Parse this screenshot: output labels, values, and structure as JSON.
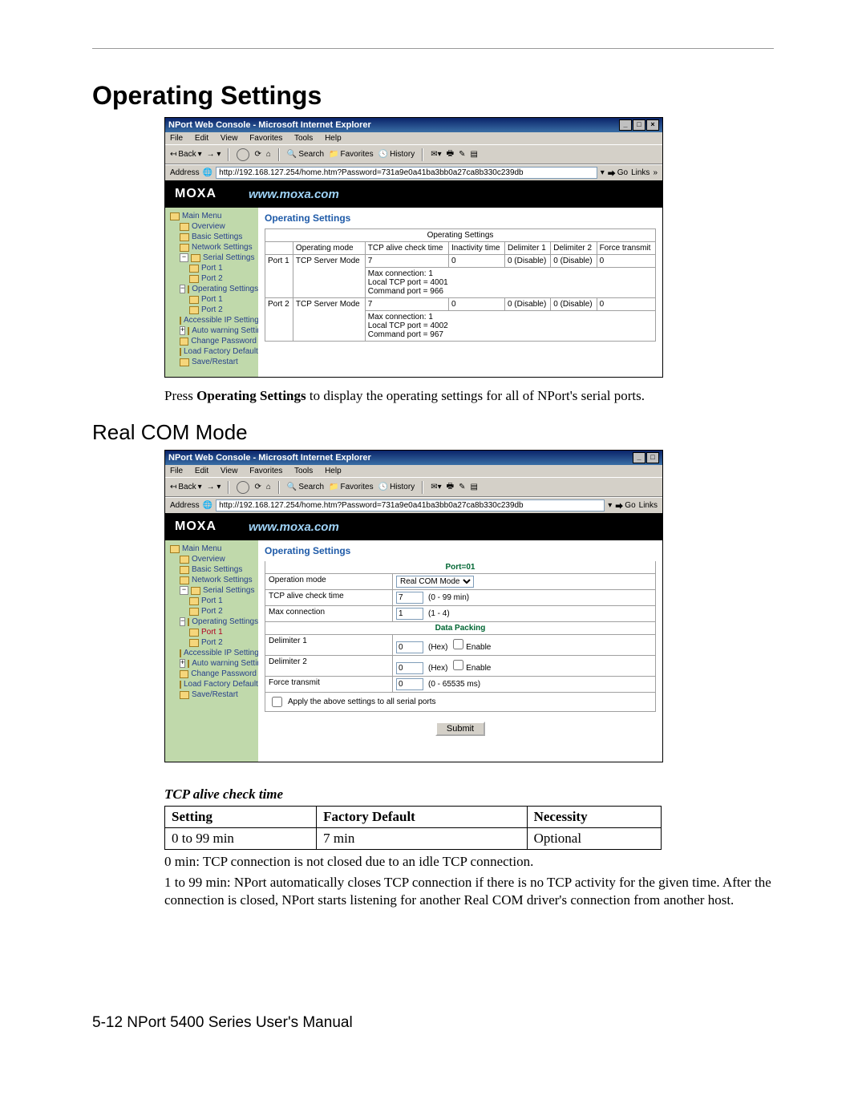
{
  "page": {
    "h1": "Operating Settings",
    "h2": "Real COM Mode",
    "footer": "5-12  NPort 5400 Series User's Manual"
  },
  "browser": {
    "title": "NPort Web Console - Microsoft Internet Explorer",
    "menu": {
      "file": "File",
      "edit": "Edit",
      "view": "View",
      "favorites": "Favorites",
      "tools": "Tools",
      "help": "Help"
    },
    "toolbar": {
      "back": "Back",
      "search": "Search",
      "fav": "Favorites",
      "hist": "History"
    },
    "address_label": "Address",
    "address_value": "http://192.168.127.254/home.htm?Password=731a9e0a41ba3bb0a27ca8b330c239db",
    "go": "Go",
    "links": "Links"
  },
  "brand": {
    "logo": "MOXA",
    "url": "www.moxa.com"
  },
  "nav": {
    "main": "Main Menu",
    "overview": "Overview",
    "basic": "Basic Settings",
    "network": "Network Settings",
    "serial": "Serial Settings",
    "port1": "Port 1",
    "port2": "Port 2",
    "operating": "Operating Settings",
    "accip": "Accessible IP Settings",
    "autowarn": "Auto warning Settings",
    "chgpw": "Change Password",
    "loadfact": "Load Factory Default",
    "save": "Save/Restart"
  },
  "shot1": {
    "label": "Operating Settings",
    "table_caption": "Operating Settings",
    "headers": {
      "port": "",
      "mode": "Operating mode",
      "tcp": "TCP alive check time",
      "inact": "Inactivity time",
      "d1": "Delimiter 1",
      "d2": "Delimiter 2",
      "ft": "Force transmit"
    },
    "rows": [
      {
        "port": "Port 1",
        "mode": "TCP Server Mode",
        "tcp": "7",
        "inact": "0",
        "d1": "0 (Disable)",
        "d2": "0 (Disable)",
        "ft": "0",
        "detail": "Max connection: 1\nLocal TCP port = 4001\nCommand port = 966"
      },
      {
        "port": "Port 2",
        "mode": "TCP Server Mode",
        "tcp": "7",
        "inact": "0",
        "d1": "0 (Disable)",
        "d2": "0 (Disable)",
        "ft": "0",
        "detail": "Max connection: 1\nLocal TCP port = 4002\nCommand port = 967"
      }
    ]
  },
  "caption1_pre": "Press ",
  "caption1_b": "Operating Settings",
  "caption1_post": " to display the operating settings for all of NPort's serial ports.",
  "shot2": {
    "label": "Operating Settings",
    "port_header": "Port=01",
    "opmode_label": "Operation mode",
    "opmode_value": "Real COM Mode",
    "tcp_label": "TCP alive check time",
    "tcp_value": "7",
    "tcp_hint": "(0 - 99 min)",
    "max_label": "Max connection",
    "max_value": "1",
    "max_hint": "(1 - 4)",
    "pack_header": "Data Packing",
    "d1_label": "Delimiter 1",
    "d1_value": "0",
    "hex": "(Hex)",
    "enable": "Enable",
    "d2_label": "Delimiter 2",
    "d2_value": "0",
    "ft_label": "Force transmit",
    "ft_value": "0",
    "ft_hint": "(0 - 65535 ms)",
    "apply": "Apply the above settings to all serial ports",
    "submit": "Submit"
  },
  "subhead": "TCP alive check time",
  "defn": {
    "h1": "Setting",
    "h2": "Factory Default",
    "h3": "Necessity",
    "c1": "0 to 99 min",
    "c2": "7 min",
    "c3": "Optional"
  },
  "note1": "0 min: TCP connection is not closed due to an idle TCP connection.",
  "note2": "1 to 99 min: NPort automatically closes TCP connection if there is no TCP activity for the given time. After the connection is closed, NPort starts listening for another Real COM driver's connection from another host."
}
